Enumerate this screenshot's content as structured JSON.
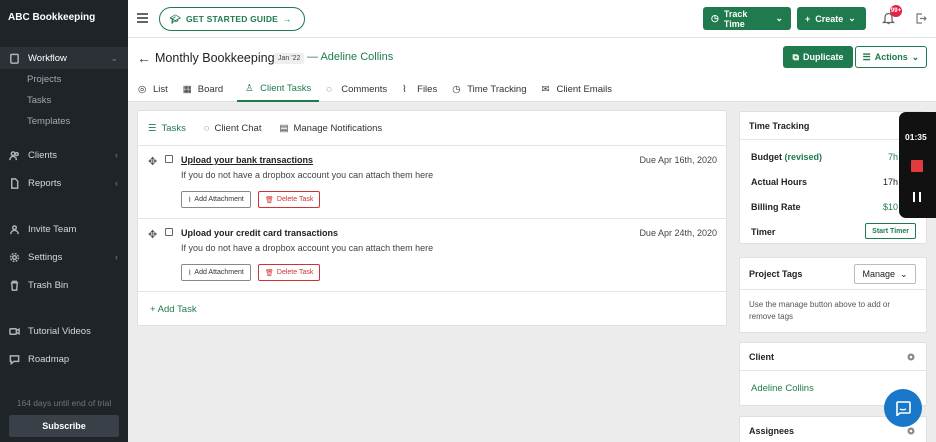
{
  "app": {
    "brand": "ABC Bookkeeping"
  },
  "sidebar": {
    "items": [
      {
        "label": "Workflow",
        "icon": "clipboard-icon",
        "active": true,
        "submenu": [
          "Projects",
          "Tasks",
          "Templates"
        ]
      },
      {
        "label": "Clients",
        "icon": "users-icon"
      },
      {
        "label": "Reports",
        "icon": "document-icon"
      },
      {
        "label": "Invite Team",
        "icon": "team-icon"
      },
      {
        "label": "Settings",
        "icon": "gear-icon"
      },
      {
        "label": "Trash Bin",
        "icon": "trash-icon"
      },
      {
        "label": "Tutorial Videos",
        "icon": "video-icon"
      },
      {
        "label": "Roadmap",
        "icon": "chat-icon"
      }
    ],
    "trial_text": "164 days until end of trial",
    "subscribe_label": "Subscribe"
  },
  "topbar": {
    "get_started": "GET STARTED GUIDE",
    "track_time": "Track Time",
    "create": "Create",
    "notification_badge": "99+"
  },
  "header": {
    "title": "Monthly Bookkeeping",
    "date_chip": "Jan '22",
    "client": "— Adeline Collins",
    "duplicate": "Duplicate",
    "actions": "Actions",
    "tabs": [
      {
        "label": "List",
        "icon": "target-icon"
      },
      {
        "label": "Board",
        "icon": "board-icon"
      },
      {
        "label": "Client Tasks",
        "icon": "user-icon",
        "active": true
      },
      {
        "label": "Comments",
        "icon": "comment-icon"
      },
      {
        "label": "Files",
        "icon": "paperclip-icon"
      },
      {
        "label": "Time Tracking",
        "icon": "clock-icon"
      },
      {
        "label": "Client Emails",
        "icon": "mail-icon"
      }
    ]
  },
  "tasks_panel": {
    "subtabs": [
      {
        "label": "Tasks",
        "icon": "list-icon",
        "active": true
      },
      {
        "label": "Client Chat",
        "icon": "chat-icon"
      },
      {
        "label": "Manage Notifications",
        "icon": "calendar-icon"
      }
    ],
    "tasks": [
      {
        "name": "Upload your bank transactions",
        "description": "If you do not have a dropbox account you can attach them here",
        "due": "Due Apr 16th, 2020",
        "attach_label": "Add Attachment",
        "delete_label": "Delete Task"
      },
      {
        "name": "Upload your credit card transactions",
        "description": "If you do not have a dropbox account you can attach them here",
        "due": "Due Apr 24th, 2020",
        "attach_label": "Add Attachment",
        "delete_label": "Delete Task"
      }
    ],
    "add_task": "+ Add Task"
  },
  "time_tracking": {
    "title": "Time Tracking",
    "budget_label": "Budget",
    "budget_revised": "(revised)",
    "budget_value": "7h",
    "actual_label": "Actual Hours",
    "actual_value": "17h",
    "billing_label": "Billing Rate",
    "billing_value": "$10",
    "timer_label": "Timer",
    "start_timer": "Start Timer"
  },
  "project_tags": {
    "title": "Project Tags",
    "manage": "Manage",
    "help": "Use the manage button above to add or remove tags"
  },
  "client_card": {
    "title": "Client",
    "name": "Adeline Collins"
  },
  "assignees_card": {
    "title": "Assignees"
  },
  "recording": {
    "time": "01:35"
  },
  "colors": {
    "brand_green": "#1f7a4d",
    "sidebar_bg": "#1f2429",
    "danger": "#cc3333",
    "badge": "#e0244a"
  }
}
